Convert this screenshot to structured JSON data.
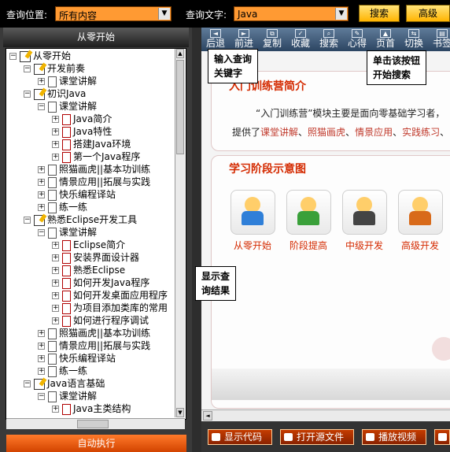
{
  "topbar": {
    "query_location_label": "查询位置:",
    "query_location_value": "所有内容",
    "query_text_label": "查询文字:",
    "query_text_value": "Java",
    "search_button": "搜索",
    "advanced_button": "高级"
  },
  "left_panel": {
    "header": "从零开始",
    "run_button": "自动执行",
    "tree": [
      {
        "label": "从零开始",
        "indent": 0,
        "expander": "-",
        "icon": "book"
      },
      {
        "label": "开发前奏",
        "indent": 1,
        "expander": "-",
        "icon": "book"
      },
      {
        "label": "课堂讲解",
        "indent": 2,
        "expander": "+",
        "icon": "page"
      },
      {
        "label": "初识Java",
        "indent": 1,
        "expander": "-",
        "icon": "book"
      },
      {
        "label": "课堂讲解",
        "indent": 2,
        "expander": "-",
        "icon": "page"
      },
      {
        "label": "Java简介",
        "indent": 3,
        "expander": "+",
        "icon": "pagered"
      },
      {
        "label": "Java特性",
        "indent": 3,
        "expander": "+",
        "icon": "pagered"
      },
      {
        "label": "搭建Java环境",
        "indent": 3,
        "expander": "+",
        "icon": "pagered"
      },
      {
        "label": "第一个Java程序",
        "indent": 3,
        "expander": "+",
        "icon": "pagered"
      },
      {
        "label": "照猫画虎||基本功训练",
        "indent": 2,
        "expander": "+",
        "icon": "page"
      },
      {
        "label": "情景应用||拓展与实践",
        "indent": 2,
        "expander": "+",
        "icon": "page"
      },
      {
        "label": "快乐编程译站",
        "indent": 2,
        "expander": "+",
        "icon": "page"
      },
      {
        "label": "练一练",
        "indent": 2,
        "expander": "+",
        "icon": "page"
      },
      {
        "label": "熟悉Eclipse开发工具",
        "indent": 1,
        "expander": "-",
        "icon": "book"
      },
      {
        "label": "课堂讲解",
        "indent": 2,
        "expander": "-",
        "icon": "page"
      },
      {
        "label": "Eclipse简介",
        "indent": 3,
        "expander": "+",
        "icon": "pagered"
      },
      {
        "label": "安装界面设计器",
        "indent": 3,
        "expander": "+",
        "icon": "pagered"
      },
      {
        "label": "熟悉Eclipse",
        "indent": 3,
        "expander": "+",
        "icon": "pagered"
      },
      {
        "label": "如何开发Java程序",
        "indent": 3,
        "expander": "+",
        "icon": "pagered"
      },
      {
        "label": "如何开发桌面应用程序",
        "indent": 3,
        "expander": "+",
        "icon": "pagered"
      },
      {
        "label": "为项目添加类库的常用",
        "indent": 3,
        "expander": "+",
        "icon": "pagered"
      },
      {
        "label": "如何进行程序调试",
        "indent": 3,
        "expander": "+",
        "icon": "pagered"
      },
      {
        "label": "照猫画虎||基本功训练",
        "indent": 2,
        "expander": "+",
        "icon": "page"
      },
      {
        "label": "情景应用||拓展与实践",
        "indent": 2,
        "expander": "+",
        "icon": "page"
      },
      {
        "label": "快乐编程译站",
        "indent": 2,
        "expander": "+",
        "icon": "page"
      },
      {
        "label": "练一练",
        "indent": 2,
        "expander": "+",
        "icon": "page"
      },
      {
        "label": "Java语言基础",
        "indent": 1,
        "expander": "-",
        "icon": "book"
      },
      {
        "label": "课堂讲解",
        "indent": 2,
        "expander": "-",
        "icon": "page"
      },
      {
        "label": "Java主类结构",
        "indent": 3,
        "expander": "+",
        "icon": "pagered"
      }
    ]
  },
  "toolbar": {
    "items": [
      "后退",
      "前进",
      "复制",
      "收藏",
      "搜索",
      "心得",
      "页首",
      "切换",
      "书签"
    ]
  },
  "content": {
    "intro_title": "入门训练营简介",
    "intro_line1": "“入门训练营”模块主要是面向零基础学习者，",
    "intro_line2_prefix": "提供了",
    "intro_links": [
      "课堂讲解",
      "照猫画虎",
      "情景应用",
      "实践练习"
    ],
    "stage_title": "学习阶段示意图",
    "stages": [
      "从零开始",
      "阶段提高",
      "中级开发",
      "高级开发"
    ]
  },
  "bottombar": {
    "show_code": "显示代码",
    "open_source": "打开源文件",
    "play_video": "播放视频"
  },
  "callouts": {
    "input_keyword": [
      "输入查询",
      "关键字"
    ],
    "click_search": [
      "单击该按钮",
      "开始搜索"
    ],
    "show_results": [
      "显示查",
      "询结果"
    ]
  }
}
